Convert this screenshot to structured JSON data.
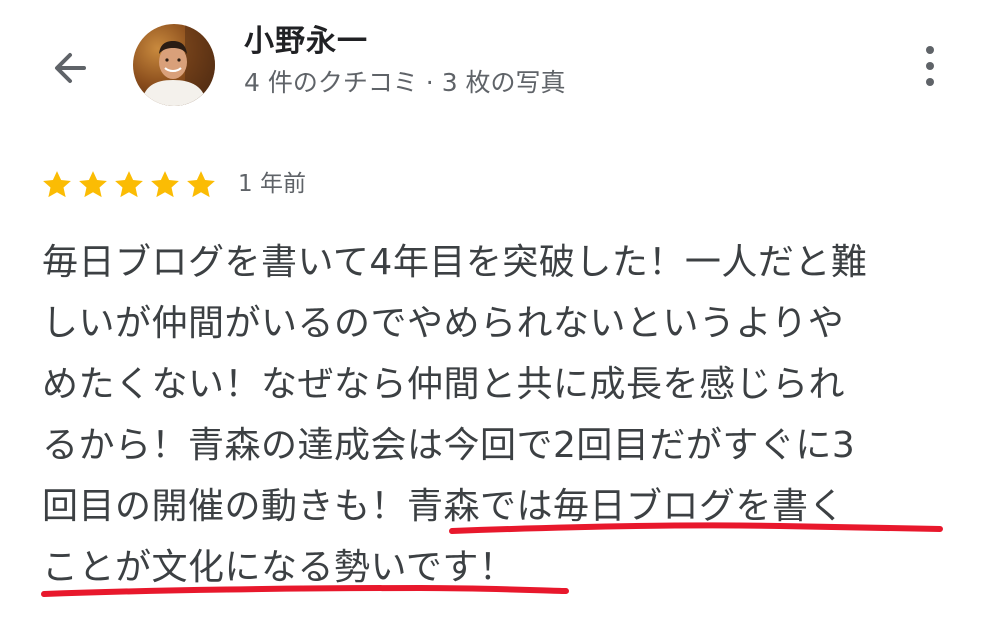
{
  "header": {
    "reviewer_name": "小野永一",
    "reviewer_stats": "4 件のクチコミ · 3 枚の写真",
    "back_icon": "arrow-left-icon",
    "more_icon": "more-vertical-icon"
  },
  "review": {
    "rating": 5,
    "max_rating": 5,
    "time": "1 年前",
    "lines": [
      "毎日ブログを書いて4年目を突破した！一人だと難",
      "しいが仲間がいるのでやめられないというよりや",
      "めたくない！なぜなら仲間と共に成長を感じられ",
      "るから！青森の達成会は今回で2回目だがすぐに3",
      "回目の開催の動きも！青森では毎日ブログを書く",
      "ことが文化になる勢いです！"
    ]
  },
  "colors": {
    "star": "#fbbc04",
    "underline": "#e8182c",
    "text": "#3c4043",
    "secondary": "#5f6368"
  }
}
